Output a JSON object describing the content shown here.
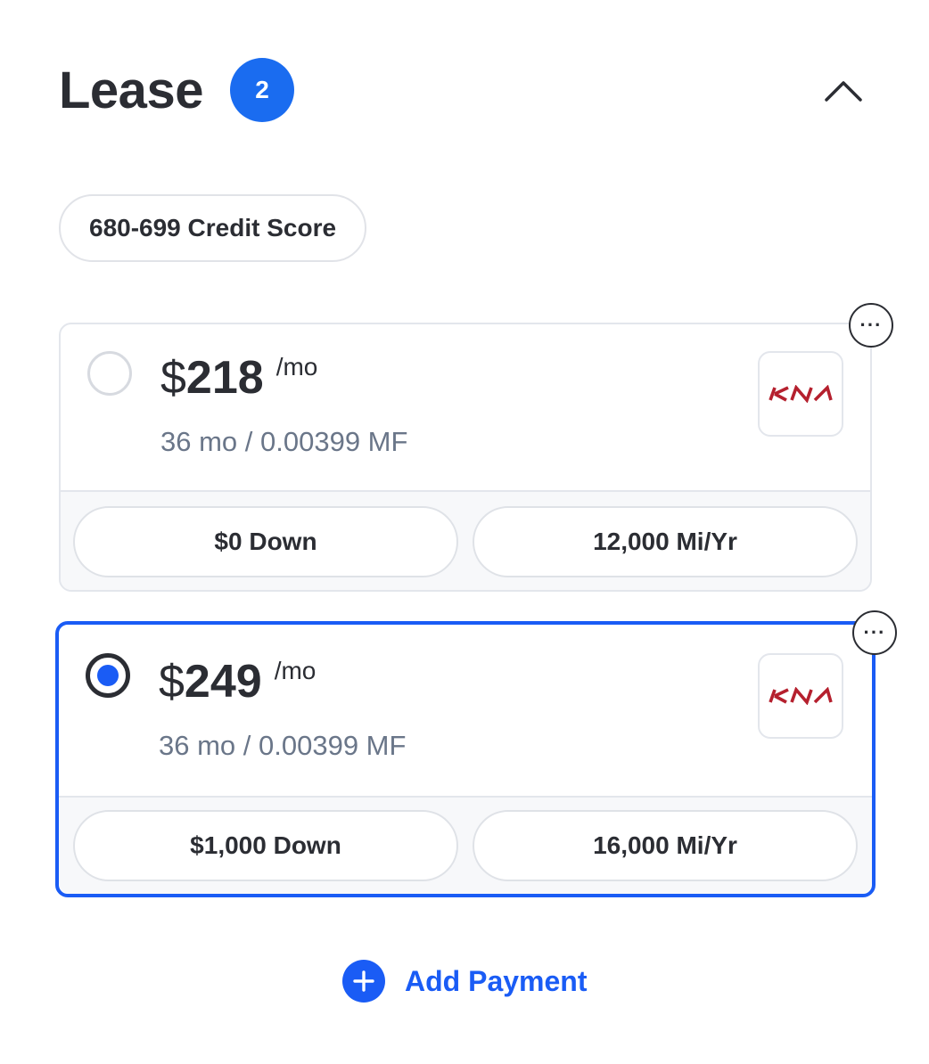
{
  "header": {
    "title": "Lease",
    "count": "2",
    "collapse_icon": "chevron-up-icon"
  },
  "filters": {
    "credit_score": "680-699 Credit Score"
  },
  "offers": [
    {
      "selected": false,
      "currency": "$",
      "amount": "218",
      "per": "/mo",
      "terms": "36 mo / 0.00399 MF",
      "brand_logo": "kia-logo",
      "down": "$0 Down",
      "mileage": "12,000 Mi/Yr",
      "menu_icon": "more-horizontal-icon"
    },
    {
      "selected": true,
      "currency": "$",
      "amount": "249",
      "per": "/mo",
      "terms": "36 mo / 0.00399 MF",
      "brand_logo": "kia-logo",
      "down": "$1,000 Down",
      "mileage": "16,000 Mi/Yr",
      "menu_icon": "more-horizontal-icon"
    }
  ],
  "actions": {
    "add_payment_label": "Add Payment",
    "add_icon": "plus-icon"
  },
  "colors": {
    "accent": "#1a5cf5",
    "badge": "#1a6cf0",
    "brand_logo": "#b5202e",
    "text": "#2b2d33",
    "muted_text": "#6a7689"
  }
}
